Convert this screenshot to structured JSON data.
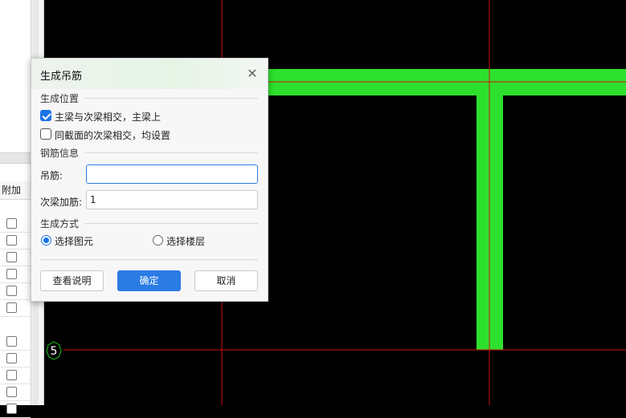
{
  "left_panel": {
    "column_header": "附加",
    "rows_checked": [
      false,
      false,
      false,
      false,
      false,
      false,
      false,
      false,
      false,
      false,
      false
    ]
  },
  "canvas": {
    "axis_marker": "5",
    "colors": {
      "background": "#000000",
      "beam": "#2ee02e",
      "axis": "#d01010"
    }
  },
  "dialog": {
    "title": "生成吊筋",
    "close_icon": "close-icon",
    "position_section": {
      "label": "生成位置",
      "option1": {
        "label": "主梁与次梁相交，主梁上",
        "checked": true
      },
      "option2": {
        "label": "同截面的次梁相交，均设置",
        "checked": false
      }
    },
    "rebar_section": {
      "label": "钢筋信息",
      "hanger_label": "吊筋:",
      "hanger_value": "",
      "secondary_label": "次梁加筋:",
      "secondary_value": "1"
    },
    "method_section": {
      "label": "生成方式",
      "option1": {
        "label": "选择图元",
        "selected": true
      },
      "option2": {
        "label": "选择楼层",
        "selected": false
      }
    },
    "buttons": {
      "help": "查看说明",
      "ok": "确定",
      "cancel": "取消"
    }
  }
}
